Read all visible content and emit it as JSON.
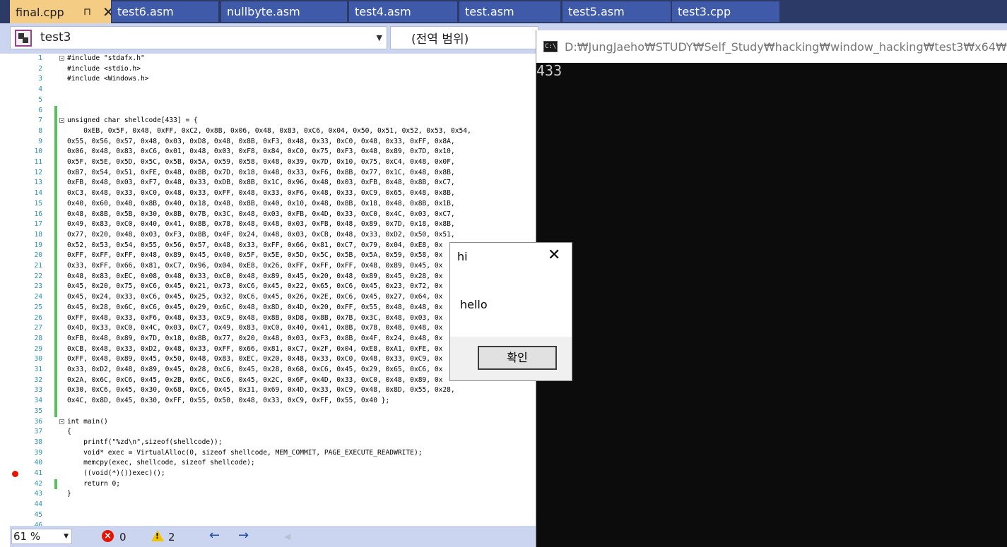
{
  "tabs": [
    {
      "label": "final.cpp",
      "active": true
    },
    {
      "label": "test6.asm"
    },
    {
      "label": "nullbyte.asm"
    },
    {
      "label": "test4.asm"
    },
    {
      "label": "test.asm"
    },
    {
      "label": "test5.asm"
    },
    {
      "label": "test3.cpp"
    }
  ],
  "tab_pin_glyph": "⊓",
  "tab_close_glyph": "✕",
  "navbar": {
    "project": "test3",
    "scope": "(전역 범위)"
  },
  "code_lines": [
    {
      "n": "1",
      "t": "#include \"stdafx.h\""
    },
    {
      "n": "2",
      "t": "#include <stdio.h>"
    },
    {
      "n": "3",
      "t": "#include <Windows.h>"
    },
    {
      "n": "4",
      "t": ""
    },
    {
      "n": "5",
      "t": ""
    },
    {
      "n": "6",
      "t": ""
    },
    {
      "n": "7",
      "t": "unsigned char shellcode[433] = {"
    },
    {
      "n": "8",
      "t": "    0xEB, 0x5F, 0x48, 0xFF, 0xC2, 0x8B, 0x06, 0x48, 0x83, 0xC6, 0x04, 0x50, 0x51, 0x52, 0x53, 0x54,"
    },
    {
      "n": "9",
      "t": "0x55, 0x56, 0x57, 0x48, 0x03, 0xD8, 0x48, 0x8B, 0xF3, 0x48, 0x33, 0xC0, 0x48, 0x33, 0xFF, 0x8A,"
    },
    {
      "n": "10",
      "t": "0x06, 0x48, 0x83, 0xC6, 0x01, 0x48, 0x03, 0xF8, 0x84, 0xC0, 0x75, 0xF3, 0x48, 0x89, 0x7D, 0x10,"
    },
    {
      "n": "11",
      "t": "0x5F, 0x5E, 0x5D, 0x5C, 0x5B, 0x5A, 0x59, 0x58, 0x48, 0x39, 0x7D, 0x10, 0x75, 0xC4, 0x48, 0x0F,"
    },
    {
      "n": "12",
      "t": "0xB7, 0x54, 0x51, 0xFE, 0x48, 0x8B, 0x7D, 0x18, 0x48, 0x33, 0xF6, 0x8B, 0x77, 0x1C, 0x48, 0x8B,"
    },
    {
      "n": "13",
      "t": "0xFB, 0x48, 0x03, 0xF7, 0x48, 0x33, 0xDB, 0x8B, 0x1C, 0x96, 0x48, 0x03, 0xFB, 0x48, 0x8B, 0xC7,"
    },
    {
      "n": "14",
      "t": "0xC3, 0x48, 0x33, 0xC0, 0x48, 0x33, 0xFF, 0x48, 0x33, 0xF6, 0x48, 0x33, 0xC9, 0x65, 0x48, 0x8B,"
    },
    {
      "n": "15",
      "t": "0x40, 0x60, 0x48, 0x8B, 0x40, 0x18, 0x48, 0x8B, 0x40, 0x10, 0x48, 0x8B, 0x18, 0x48, 0x8B, 0x1B,"
    },
    {
      "n": "16",
      "t": "0x48, 0x8B, 0x5B, 0x30, 0x8B, 0x7B, 0x3C, 0x48, 0x03, 0xFB, 0x4D, 0x33, 0xC0, 0x4C, 0x03, 0xC7,"
    },
    {
      "n": "17",
      "t": "0x49, 0x83, 0xC0, 0x40, 0x41, 0x8B, 0x78, 0x48, 0x48, 0x03, 0xFB, 0x48, 0x89, 0x7D, 0x18, 0x8B,"
    },
    {
      "n": "18",
      "t": "0x77, 0x20, 0x48, 0x03, 0xF3, 0x8B, 0x4F, 0x24, 0x48, 0x03, 0xCB, 0x48, 0x33, 0xD2, 0x50, 0x51,"
    },
    {
      "n": "19",
      "t": "0x52, 0x53, 0x54, 0x55, 0x56, 0x57, 0x48, 0x33, 0xFF, 0x66, 0x81, 0xC7, 0x79, 0x04, 0xE8, 0x"
    },
    {
      "n": "20",
      "t": "0xFF, 0xFF, 0xFF, 0x48, 0x89, 0x45, 0x40, 0x5F, 0x5E, 0x5D, 0x5C, 0x5B, 0x5A, 0x59, 0x58, 0x"
    },
    {
      "n": "21",
      "t": "0x33, 0xFF, 0x66, 0x81, 0xC7, 0x96, 0x04, 0xE8, 0x26, 0xFF, 0xFF, 0xFF, 0x48, 0x89, 0x45, 0x"
    },
    {
      "n": "22",
      "t": "0x48, 0x83, 0xEC, 0x08, 0x48, 0x33, 0xC0, 0x48, 0x89, 0x45, 0x20, 0x48, 0x89, 0x45, 0x28, 0x"
    },
    {
      "n": "23",
      "t": "0x45, 0x20, 0x75, 0xC6, 0x45, 0x21, 0x73, 0xC6, 0x45, 0x22, 0x65, 0xC6, 0x45, 0x23, 0x72, 0x"
    },
    {
      "n": "24",
      "t": "0x45, 0x24, 0x33, 0xC6, 0x45, 0x25, 0x32, 0xC6, 0x45, 0x26, 0x2E, 0xC6, 0x45, 0x27, 0x64, 0x"
    },
    {
      "n": "25",
      "t": "0x45, 0x28, 0x6C, 0xC6, 0x45, 0x29, 0x6C, 0x48, 0x8D, 0x4D, 0x20, 0xFF, 0x55, 0x48, 0x48, 0x"
    },
    {
      "n": "26",
      "t": "0xFF, 0x48, 0x33, 0xF6, 0x48, 0x33, 0xC9, 0x48, 0x8B, 0xD8, 0x8B, 0x7B, 0x3C, 0x48, 0x03, 0x"
    },
    {
      "n": "27",
      "t": "0x4D, 0x33, 0xC0, 0x4C, 0x03, 0xC7, 0x49, 0x83, 0xC0, 0x40, 0x41, 0x8B, 0x78, 0x48, 0x48, 0x"
    },
    {
      "n": "28",
      "t": "0xFB, 0x48, 0x89, 0x7D, 0x18, 0x8B, 0x77, 0x20, 0x48, 0x03, 0xF3, 0x8B, 0x4F, 0x24, 0x48, 0x"
    },
    {
      "n": "29",
      "t": "0xCB, 0x48, 0x33, 0xD2, 0x48, 0x33, 0xFF, 0x66, 0x81, 0xC7, 0x2F, 0x04, 0xE8, 0xA1, 0xFE, 0x"
    },
    {
      "n": "30",
      "t": "0xFF, 0x48, 0x89, 0x45, 0x50, 0x48, 0x83, 0xEC, 0x20, 0x48, 0x33, 0xC0, 0x48, 0x33, 0xC9, 0x"
    },
    {
      "n": "31",
      "t": "0x33, 0xD2, 0x48, 0x89, 0x45, 0x28, 0xC6, 0x45, 0x28, 0x68, 0xC6, 0x45, 0x29, 0x65, 0xC6, 0x"
    },
    {
      "n": "32",
      "t": "0x2A, 0x6C, 0xC6, 0x45, 0x2B, 0x6C, 0xC6, 0x45, 0x2C, 0x6F, 0x4D, 0x33, 0xC0, 0x48, 0x89, 0x"
    },
    {
      "n": "33",
      "t": "0x30, 0xC6, 0x45, 0x30, 0x68, 0xC6, 0x45, 0x31, 0x69, 0x4D, 0x33, 0xC9, 0x48, 0x8D, 0x55, 0x28,"
    },
    {
      "n": "34",
      "t": "0x4C, 0x8D, 0x45, 0x30, 0xFF, 0x55, 0x50, 0x48, 0x33, 0xC9, 0xFF, 0x55, 0x40 };"
    },
    {
      "n": "35",
      "t": ""
    },
    {
      "n": "36",
      "t": "int main()"
    },
    {
      "n": "37",
      "t": "{"
    },
    {
      "n": "38",
      "t": "    printf(\"%zd\\n\",sizeof(shellcode));"
    },
    {
      "n": "39",
      "t": "    void* exec = VirtualAlloc(0, sizeof shellcode, MEM_COMMIT, PAGE_EXECUTE_READWRITE);"
    },
    {
      "n": "40",
      "t": "    memcpy(exec, shellcode, sizeof shellcode);"
    },
    {
      "n": "41",
      "t": "    ((void(*)())exec)();"
    },
    {
      "n": "42",
      "t": "    return 0;"
    },
    {
      "n": "43",
      "t": "}"
    },
    {
      "n": "44",
      "t": ""
    },
    {
      "n": "45",
      "t": ""
    },
    {
      "n": "46",
      "t": ""
    }
  ],
  "status": {
    "zoom": "61 %",
    "errors": "0",
    "warnings": "2",
    "back_glyph": "←",
    "forward_glyph": "→",
    "disabled_glyph": "◀"
  },
  "console": {
    "icon_text": "C:\\",
    "title": "D:₩JungJaeho₩STUDY₩Self_Study₩hacking₩window_hacking₩test3₩x64₩D",
    "output": "433"
  },
  "messagebox": {
    "title": "hi",
    "close_glyph": "✕",
    "text": "hello",
    "ok_label": "확인"
  },
  "colors": {
    "tab_active": "#f5cc84",
    "tab_inactive": "#3f5aa8",
    "breakpoint": "#e51400",
    "change_bar": "#57c25b"
  }
}
